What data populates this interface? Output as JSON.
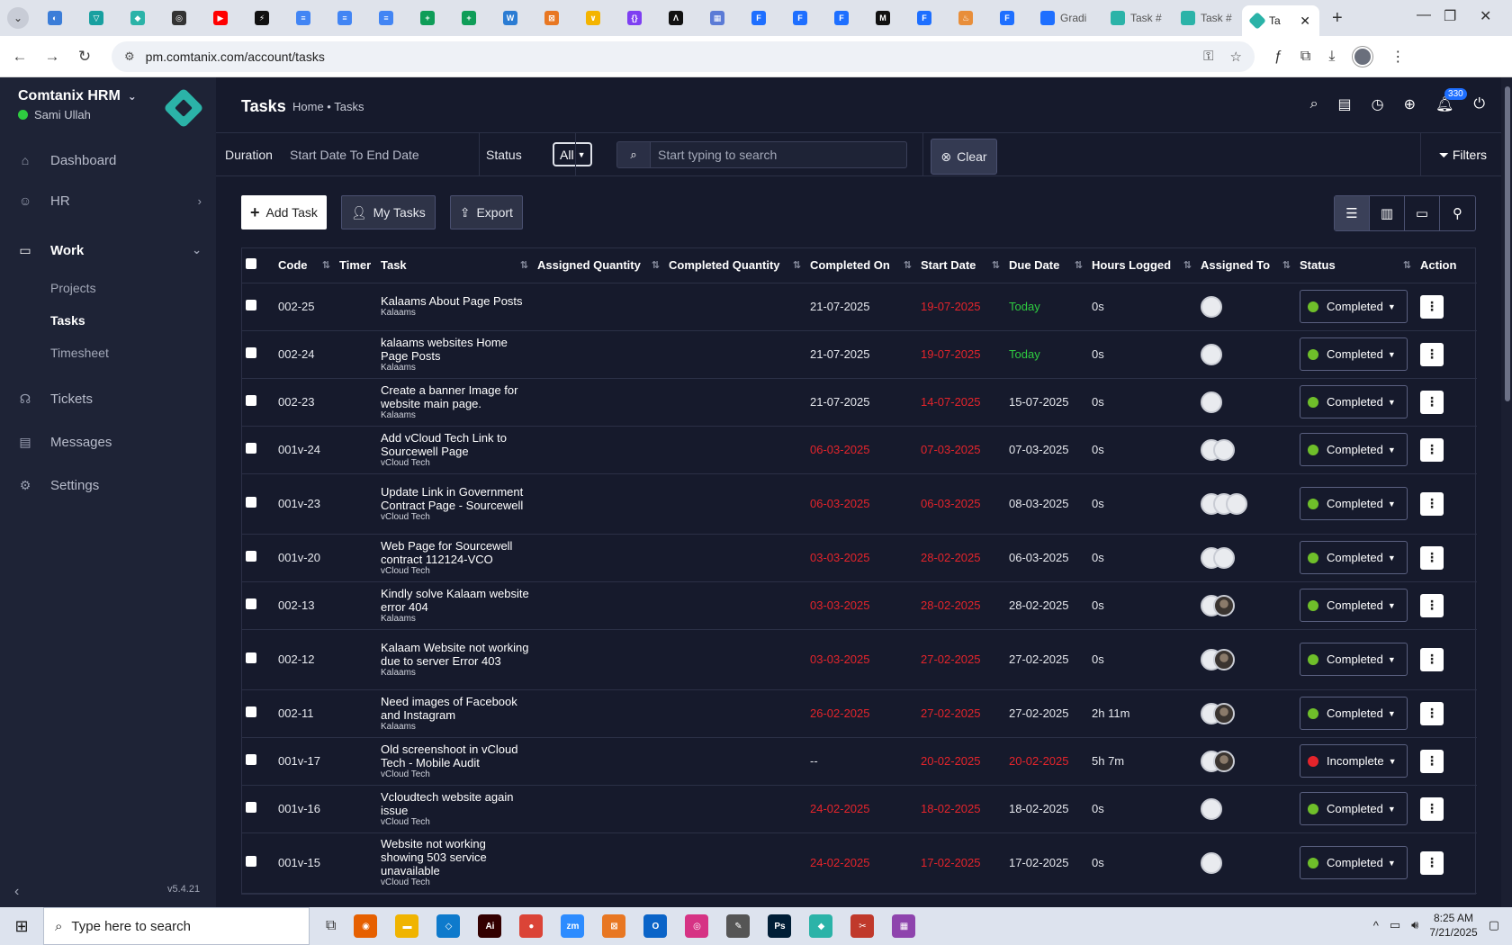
{
  "browser": {
    "url": "pm.comtanix.com/account/tasks",
    "text_tabs": [
      {
        "label": "Gradi",
        "color": "#1e6fff"
      },
      {
        "label": "Task #",
        "color": "#2bb3a8"
      },
      {
        "label": "Task #",
        "color": "#2bb3a8"
      }
    ],
    "active_tab": {
      "label": "Ta"
    },
    "favicons": [
      {
        "glyph": "◐",
        "color": "#3b7dd8"
      },
      {
        "glyph": "▽",
        "color": "#18a0a0"
      },
      {
        "glyph": "◆",
        "color": "#2bb3a8"
      },
      {
        "glyph": "◎",
        "color": "#333333"
      },
      {
        "glyph": "▶",
        "color": "#ff0000"
      },
      {
        "glyph": "⚡",
        "color": "#111111"
      },
      {
        "glyph": "≡",
        "color": "#4285f4"
      },
      {
        "glyph": "≡",
        "color": "#4285f4"
      },
      {
        "glyph": "≡",
        "color": "#4285f4"
      },
      {
        "glyph": "+",
        "color": "#0f9d58"
      },
      {
        "glyph": "+",
        "color": "#0f9d58"
      },
      {
        "glyph": "W",
        "color": "#2b7cd3"
      },
      {
        "glyph": "⊠",
        "color": "#e87722"
      },
      {
        "glyph": "∨",
        "color": "#f4b400"
      },
      {
        "glyph": "{}",
        "color": "#7e3ff2"
      },
      {
        "glyph": "Λ",
        "color": "#111111"
      },
      {
        "glyph": "▦",
        "color": "#5b7bd6"
      },
      {
        "glyph": "F",
        "color": "#1e6fff"
      },
      {
        "glyph": "F",
        "color": "#1e6fff"
      },
      {
        "glyph": "F",
        "color": "#1e6fff"
      },
      {
        "glyph": "M",
        "color": "#111111"
      },
      {
        "glyph": "F",
        "color": "#1e6fff"
      },
      {
        "glyph": "♨",
        "color": "#e88e3a"
      },
      {
        "glyph": "F",
        "color": "#1e6fff"
      }
    ]
  },
  "sidebar": {
    "company": "Comtanix HRM",
    "user": "Sami Ullah",
    "items": [
      {
        "label": "Dashboard",
        "icon": "⌂"
      },
      {
        "label": "HR",
        "icon": "☺"
      },
      {
        "label": "Work",
        "icon": "▭"
      },
      {
        "label": "Tickets",
        "icon": "☊"
      },
      {
        "label": "Messages",
        "icon": "▤"
      },
      {
        "label": "Settings",
        "icon": "⚙"
      }
    ],
    "work_sub": [
      "Projects",
      "Tasks",
      "Timesheet"
    ],
    "version": "v5.4.21"
  },
  "header": {
    "title": "Tasks",
    "breadcrumb": "Home • Tasks",
    "notification_count": "330"
  },
  "filters": {
    "duration_label": "Duration",
    "duration_value": "Start Date To End Date",
    "status_label": "Status",
    "status_value": "All",
    "search_placeholder": "Start typing to search",
    "clear_label": "Clear",
    "filters_label": "Filters"
  },
  "toolbar": {
    "add_task": "Add Task",
    "my_tasks": "My Tasks",
    "export": "Export"
  },
  "table": {
    "columns": [
      "Code",
      "Timer",
      "Task",
      "Assigned Quantity",
      "Completed Quantity",
      "Completed On",
      "Start Date",
      "Due Date",
      "Hours Logged",
      "Assigned To",
      "Status",
      "Action"
    ],
    "rows": [
      {
        "code": "002-25",
        "title": "Kalaams About Page Posts",
        "project": "Kalaams",
        "completed_on": "21-07-2025",
        "completed_red": false,
        "start": "19-07-2025",
        "start_red": true,
        "due": "Today",
        "due_color": "green",
        "hours": "0s",
        "avatars": [
          "plain"
        ],
        "status": "Completed",
        "status_color": "#6fbf2a"
      },
      {
        "code": "002-24",
        "title": "kalaams websites Home Page Posts",
        "project": "Kalaams",
        "completed_on": "21-07-2025",
        "completed_red": false,
        "start": "19-07-2025",
        "start_red": true,
        "due": "Today",
        "due_color": "green",
        "hours": "0s",
        "avatars": [
          "plain"
        ],
        "status": "Completed",
        "status_color": "#6fbf2a"
      },
      {
        "code": "002-23",
        "title": "Create a banner Image for website main page.",
        "project": "Kalaams",
        "completed_on": "21-07-2025",
        "completed_red": false,
        "start": "14-07-2025",
        "start_red": true,
        "due": "15-07-2025",
        "due_color": "normal",
        "hours": "0s",
        "avatars": [
          "plain"
        ],
        "status": "Completed",
        "status_color": "#6fbf2a"
      },
      {
        "code": "001v-24",
        "title": "Add vCloud Tech Link to Sourcewell Page",
        "project": "vCloud Tech",
        "completed_on": "06-03-2025",
        "completed_red": true,
        "start": "07-03-2025",
        "start_red": true,
        "due": "07-03-2025",
        "due_color": "normal",
        "hours": "0s",
        "avatars": [
          "plain",
          "plain"
        ],
        "status": "Completed",
        "status_color": "#6fbf2a"
      },
      {
        "code": "001v-23",
        "title": "Update Link in Government Contract Page - Sourcewell",
        "project": "vCloud Tech",
        "completed_on": "06-03-2025",
        "completed_red": true,
        "start": "06-03-2025",
        "start_red": true,
        "due": "08-03-2025",
        "due_color": "normal",
        "hours": "0s",
        "avatars": [
          "plain",
          "plain",
          "plain"
        ],
        "status": "Completed",
        "status_color": "#6fbf2a"
      },
      {
        "code": "001v-20",
        "title": "Web Page for Sourcewell contract 112124-VCO",
        "project": "vCloud Tech",
        "completed_on": "03-03-2025",
        "completed_red": true,
        "start": "28-02-2025",
        "start_red": true,
        "due": "06-03-2025",
        "due_color": "normal",
        "hours": "0s",
        "avatars": [
          "plain",
          "plain"
        ],
        "status": "Completed",
        "status_color": "#6fbf2a"
      },
      {
        "code": "002-13",
        "title": "Kindly solve Kalaam website error 404",
        "project": "Kalaams",
        "completed_on": "03-03-2025",
        "completed_red": true,
        "start": "28-02-2025",
        "start_red": true,
        "due": "28-02-2025",
        "due_color": "normal",
        "hours": "0s",
        "avatars": [
          "plain",
          "photo"
        ],
        "status": "Completed",
        "status_color": "#6fbf2a"
      },
      {
        "code": "002-12",
        "title": "Kalaam Website not working due to server Error 403",
        "project": "Kalaams",
        "completed_on": "03-03-2025",
        "completed_red": true,
        "start": "27-02-2025",
        "start_red": true,
        "due": "27-02-2025",
        "due_color": "normal",
        "hours": "0s",
        "avatars": [
          "plain",
          "photo"
        ],
        "status": "Completed",
        "status_color": "#6fbf2a"
      },
      {
        "code": "002-11",
        "title": "Need images of Facebook and Instagram",
        "project": "Kalaams",
        "completed_on": "26-02-2025",
        "completed_red": true,
        "start": "27-02-2025",
        "start_red": true,
        "due": "27-02-2025",
        "due_color": "normal",
        "hours": "2h 11m",
        "avatars": [
          "plain",
          "photo"
        ],
        "status": "Completed",
        "status_color": "#6fbf2a"
      },
      {
        "code": "001v-17",
        "title": "Old screenshoot in vCloud Tech - Mobile Audit",
        "project": "vCloud Tech",
        "completed_on": "--",
        "completed_red": false,
        "start": "20-02-2025",
        "start_red": true,
        "due": "20-02-2025",
        "due_color": "red",
        "hours": "5h 7m",
        "avatars": [
          "plain",
          "photo"
        ],
        "status": "Incomplete",
        "status_color": "#e5242b"
      },
      {
        "code": "001v-16",
        "title": "Vcloudtech website again issue",
        "project": "vCloud Tech",
        "completed_on": "24-02-2025",
        "completed_red": true,
        "start": "18-02-2025",
        "start_red": true,
        "due": "18-02-2025",
        "due_color": "normal",
        "hours": "0s",
        "avatars": [
          "plain"
        ],
        "status": "Completed",
        "status_color": "#6fbf2a"
      },
      {
        "code": "001v-15",
        "title": "Website not working showing 503 service unavailable",
        "project": "vCloud Tech",
        "completed_on": "24-02-2025",
        "completed_red": true,
        "start": "17-02-2025",
        "start_red": true,
        "due": "17-02-2025",
        "due_color": "normal",
        "hours": "0s",
        "avatars": [
          "plain"
        ],
        "status": "Completed",
        "status_color": "#6fbf2a"
      }
    ]
  },
  "taskbar": {
    "search_placeholder": "Type here to search",
    "time": "8:25 AM",
    "date": "7/21/2025",
    "apps": [
      {
        "glyph": "◉",
        "color": "#e66000"
      },
      {
        "glyph": "▬",
        "color": "#f0b400"
      },
      {
        "glyph": "◇",
        "color": "#0e7acc"
      },
      {
        "glyph": "Ai",
        "color": "#330000"
      },
      {
        "glyph": "●",
        "color": "#db4437"
      },
      {
        "glyph": "zm",
        "color": "#2d8cff"
      },
      {
        "glyph": "⊠",
        "color": "#e87722"
      },
      {
        "glyph": "O",
        "color": "#0a64c8"
      },
      {
        "glyph": "◎",
        "color": "#d63384"
      },
      {
        "glyph": "✎",
        "color": "#555555"
      },
      {
        "glyph": "Ps",
        "color": "#001e36"
      },
      {
        "glyph": "◆",
        "color": "#2bb3a8"
      },
      {
        "glyph": "✂",
        "color": "#c0392b"
      },
      {
        "glyph": "▦",
        "color": "#8e44ad"
      }
    ]
  }
}
